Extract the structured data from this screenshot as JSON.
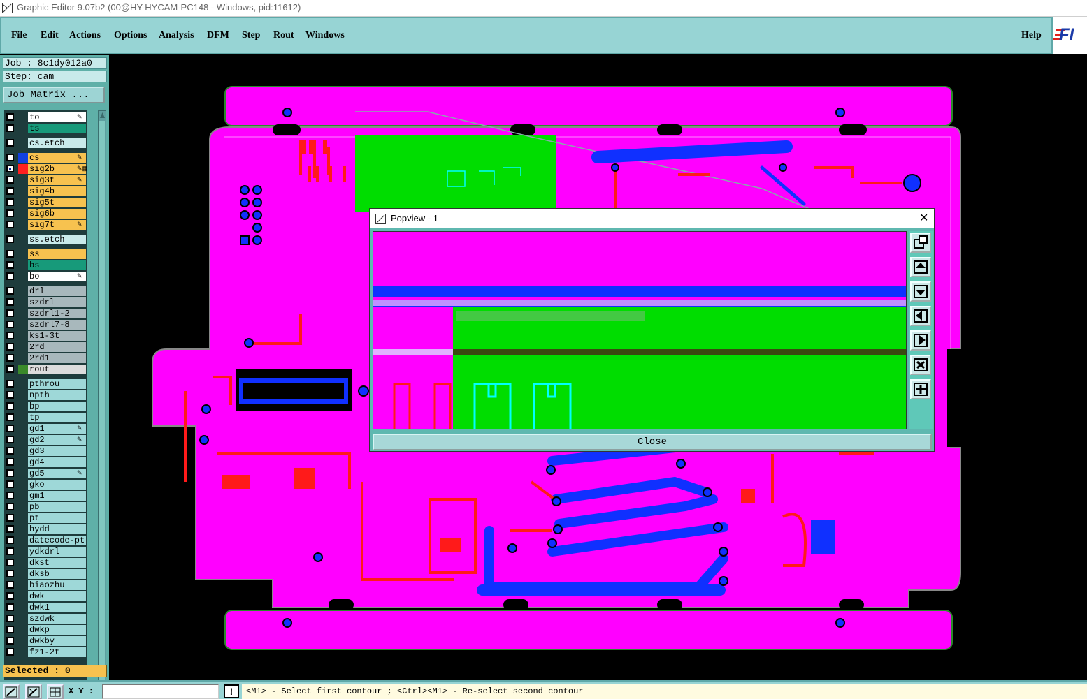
{
  "window": {
    "title": "Graphic Editor 9.07b2 (00@HY-HYCAM-PC148 - Windows, pid:11612)"
  },
  "menu": {
    "items": [
      "File",
      "Edit",
      "Actions",
      "Options",
      "Analysis",
      "DFM",
      "Step",
      "Rout",
      "Windows"
    ],
    "help": "Help",
    "logo_text": "FI"
  },
  "job": {
    "job_label": "Job : 8c1dy012a0",
    "step_label": "Step: cam",
    "matrix_button": "Job Matrix ..."
  },
  "layers": [
    {
      "name": "to",
      "bg": "#ffffff",
      "swatch": "",
      "mark": "✎"
    },
    {
      "name": "ts",
      "bg": "#179a7a",
      "swatch": "",
      "mark": ""
    },
    {
      "name": "cs.etch",
      "bg": "#c8eaea",
      "swatch": "",
      "mark": "",
      "gap": true
    },
    {
      "name": "cs",
      "bg": "#f7c24f",
      "swatch": "#1040e0",
      "mark": "✎",
      "gap": true
    },
    {
      "name": "sig2b",
      "bg": "#f7c24f",
      "swatch": "#ff2020",
      "mark": "✎▦",
      "active": true
    },
    {
      "name": "sig3t",
      "bg": "#f7c24f",
      "swatch": "",
      "mark": "✎"
    },
    {
      "name": "sig4b",
      "bg": "#f7c24f",
      "swatch": "",
      "mark": ""
    },
    {
      "name": "sig5t",
      "bg": "#f7c24f",
      "swatch": "",
      "mark": ""
    },
    {
      "name": "sig6b",
      "bg": "#f7c24f",
      "swatch": "",
      "mark": ""
    },
    {
      "name": "sig7t",
      "bg": "#f7c24f",
      "swatch": "",
      "mark": "✎"
    },
    {
      "name": "ss.etch",
      "bg": "#c8eaea",
      "swatch": "",
      "mark": "",
      "gap": true
    },
    {
      "name": "ss",
      "bg": "#f7c24f",
      "swatch": "",
      "mark": "",
      "gap": true
    },
    {
      "name": "bs",
      "bg": "#179a7a",
      "swatch": "",
      "mark": ""
    },
    {
      "name": "bo",
      "bg": "#ffffff",
      "swatch": "",
      "mark": "✎"
    },
    {
      "name": "drl",
      "bg": "#a8b8bc",
      "swatch": "",
      "mark": "",
      "gap": true
    },
    {
      "name": "szdrl",
      "bg": "#a8b8bc",
      "swatch": "",
      "mark": ""
    },
    {
      "name": "szdrl1-2",
      "bg": "#a8b8bc",
      "swatch": "",
      "mark": ""
    },
    {
      "name": "szdrl7-8",
      "bg": "#a8b8bc",
      "swatch": "",
      "mark": ""
    },
    {
      "name": "ks1-3t",
      "bg": "#a8b8bc",
      "swatch": "",
      "mark": ""
    },
    {
      "name": "2rd",
      "bg": "#a8b8bc",
      "swatch": "",
      "mark": ""
    },
    {
      "name": "2rd1",
      "bg": "#a8b8bc",
      "swatch": "",
      "mark": ""
    },
    {
      "name": "rout",
      "bg": "#dcdcdc",
      "swatch": "#3a8a2a",
      "mark": ""
    },
    {
      "name": "pthrou",
      "bg": "#9ed8d8",
      "swatch": "",
      "mark": "",
      "gap": true
    },
    {
      "name": "npth",
      "bg": "#9ed8d8",
      "swatch": "",
      "mark": ""
    },
    {
      "name": "bp",
      "bg": "#9ed8d8",
      "swatch": "",
      "mark": ""
    },
    {
      "name": "tp",
      "bg": "#9ed8d8",
      "swatch": "",
      "mark": ""
    },
    {
      "name": "gd1",
      "bg": "#9ed8d8",
      "swatch": "",
      "mark": "✎"
    },
    {
      "name": "gd2",
      "bg": "#9ed8d8",
      "swatch": "",
      "mark": "✎"
    },
    {
      "name": "gd3",
      "bg": "#9ed8d8",
      "swatch": "",
      "mark": ""
    },
    {
      "name": "gd4",
      "bg": "#9ed8d8",
      "swatch": "",
      "mark": ""
    },
    {
      "name": "gd5",
      "bg": "#9ed8d8",
      "swatch": "",
      "mark": "✎"
    },
    {
      "name": "gko",
      "bg": "#9ed8d8",
      "swatch": "",
      "mark": ""
    },
    {
      "name": "gm1",
      "bg": "#9ed8d8",
      "swatch": "",
      "mark": ""
    },
    {
      "name": "pb",
      "bg": "#9ed8d8",
      "swatch": "",
      "mark": ""
    },
    {
      "name": "pt",
      "bg": "#9ed8d8",
      "swatch": "",
      "mark": ""
    },
    {
      "name": "hydd",
      "bg": "#9ed8d8",
      "swatch": "",
      "mark": ""
    },
    {
      "name": "datecode-pt",
      "bg": "#9ed8d8",
      "swatch": "",
      "mark": ""
    },
    {
      "name": "ydkdrl",
      "bg": "#9ed8d8",
      "swatch": "",
      "mark": ""
    },
    {
      "name": "dkst",
      "bg": "#9ed8d8",
      "swatch": "",
      "mark": ""
    },
    {
      "name": "dksb",
      "bg": "#9ed8d8",
      "swatch": "",
      "mark": ""
    },
    {
      "name": "biaozhu",
      "bg": "#9ed8d8",
      "swatch": "",
      "mark": ""
    },
    {
      "name": "dwk",
      "bg": "#9ed8d8",
      "swatch": "",
      "mark": ""
    },
    {
      "name": "dwk1",
      "bg": "#9ed8d8",
      "swatch": "",
      "mark": ""
    },
    {
      "name": "szdwk",
      "bg": "#9ed8d8",
      "swatch": "",
      "mark": ""
    },
    {
      "name": "dwkp",
      "bg": "#9ed8d8",
      "swatch": "",
      "mark": ""
    },
    {
      "name": "dwkby",
      "bg": "#9ed8d8",
      "swatch": "",
      "mark": ""
    },
    {
      "name": "fz1-2t",
      "bg": "#9ed8d8",
      "swatch": "",
      "mark": ""
    }
  ],
  "selection": {
    "label": "Selected : 0"
  },
  "status": {
    "xy_label": "X Y :",
    "xy_value": "",
    "warn_icon": "!",
    "message": "<M1> - Select first contour ; <Ctrl><M1> - Re-select second contour"
  },
  "popview": {
    "title": "Popview - 1",
    "close_x": "✕",
    "close_button": "Close",
    "tools": [
      "zoom-home-icon",
      "pan-up-icon",
      "pan-down-icon",
      "pan-left-icon",
      "pan-right-icon",
      "zoom-in-icon",
      "zoom-out-icon"
    ]
  },
  "colors": {
    "board": "#ff00ff",
    "copper_red": "#ff1a1a",
    "copper_blue": "#1030ff",
    "plane_green": "#00dd00",
    "outline_cyan": "#00ffff"
  }
}
